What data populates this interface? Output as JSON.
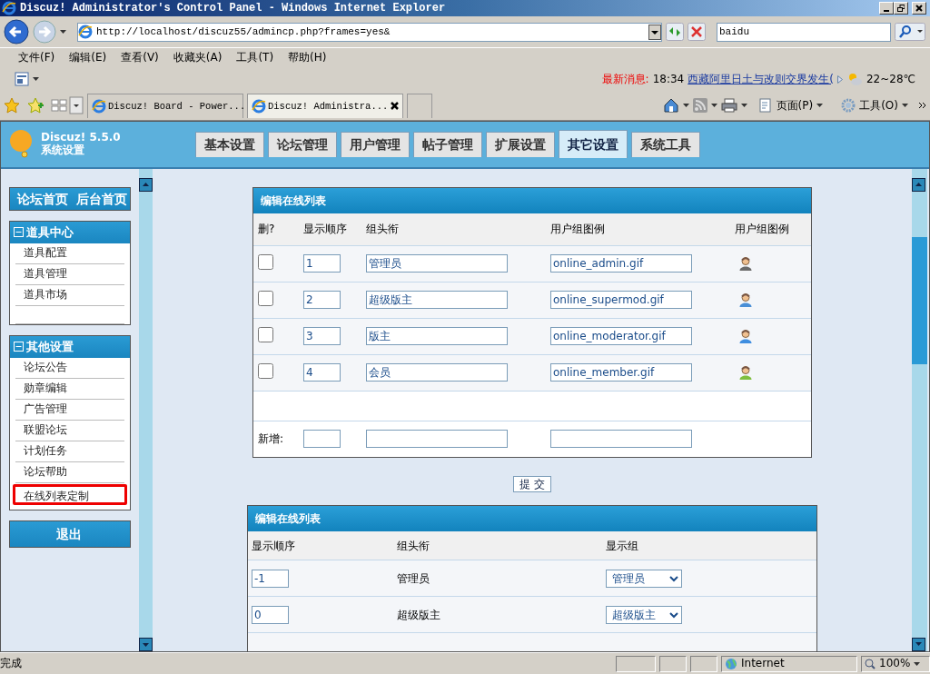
{
  "window": {
    "title": "Discuz! Administrator's Control Panel - Windows Internet Explorer"
  },
  "address_bar": {
    "url": "http://localhost/discuz55/admincp.php?frames=yes&"
  },
  "search": {
    "value": "baidu"
  },
  "menu_bar": [
    "文件(F)",
    "编辑(E)",
    "查看(V)",
    "收藏夹(A)",
    "工具(T)",
    "帮助(H)"
  ],
  "news": {
    "label": "最新消息:",
    "time": "18:34",
    "headline": "西藏阿里日土与改则交界发生(",
    "weather": "22~28℃"
  },
  "browser_tabs": [
    {
      "label": "Discuz! Board - Power...",
      "selected": false
    },
    {
      "label": "Discuz! Administra...",
      "selected": true
    }
  ],
  "command_bar": [
    "页面(P)",
    "工具(O)"
  ],
  "admin": {
    "product": "Discuz! 5.5.0",
    "section": "系统设置",
    "tabs": [
      {
        "label": "基本设置",
        "selected": false
      },
      {
        "label": "论坛管理",
        "selected": false
      },
      {
        "label": "用户管理",
        "selected": false
      },
      {
        "label": "帖子管理",
        "selected": false
      },
      {
        "label": "扩展设置",
        "selected": false
      },
      {
        "label": "其它设置",
        "selected": true
      },
      {
        "label": "系统工具",
        "selected": false
      }
    ]
  },
  "sidebar": {
    "top_links": [
      "论坛首页",
      "后台首页"
    ],
    "groups": [
      {
        "title": "道具中心",
        "expanded": true,
        "items": [
          {
            "label": "道具配置",
            "selected": false
          },
          {
            "label": "道具管理",
            "selected": false
          },
          {
            "label": "道具市场",
            "selected": false
          }
        ]
      },
      {
        "title": "其他设置",
        "expanded": true,
        "items": [
          {
            "label": "论坛公告",
            "selected": false
          },
          {
            "label": "勋章编辑",
            "selected": false
          },
          {
            "label": "广告管理",
            "selected": false
          },
          {
            "label": "联盟论坛",
            "selected": false
          },
          {
            "label": "计划任务",
            "selected": false
          },
          {
            "label": "论坛帮助",
            "selected": false
          },
          {
            "label": "在线列表定制",
            "selected": true
          }
        ]
      }
    ],
    "logout": "退出"
  },
  "group_table": {
    "title": "编辑在线列表",
    "columns": [
      "删?",
      "显示顺序",
      "组头衔",
      "用户组图例",
      "用户组图例"
    ],
    "rows": [
      {
        "checked": false,
        "order": "1",
        "title": "管理员",
        "image": "online_admin.gif",
        "color": "#6b6b6b"
      },
      {
        "checked": false,
        "order": "2",
        "title": "超级版主",
        "image": "online_supermod.gif",
        "color": "#4a8fd6"
      },
      {
        "checked": false,
        "order": "3",
        "title": "版主",
        "image": "online_moderator.gif",
        "color": "#3f8ee0"
      },
      {
        "checked": false,
        "order": "4",
        "title": "会员",
        "image": "online_member.gif",
        "color": "#7fbf3f"
      }
    ],
    "new_row_label": "新增:"
  },
  "submit": "提 交",
  "display_table": {
    "title": "编辑在线列表",
    "columns": [
      "显示顺序",
      "组头衔",
      "显示组"
    ],
    "rows": [
      {
        "order": "-1",
        "title": "管理员",
        "group": "管理员"
      },
      {
        "order": "0",
        "title": "超级版主",
        "group": "超级版主"
      }
    ]
  },
  "status_bar": {
    "text": "完成",
    "zone": "Internet",
    "zoom": "100%"
  }
}
